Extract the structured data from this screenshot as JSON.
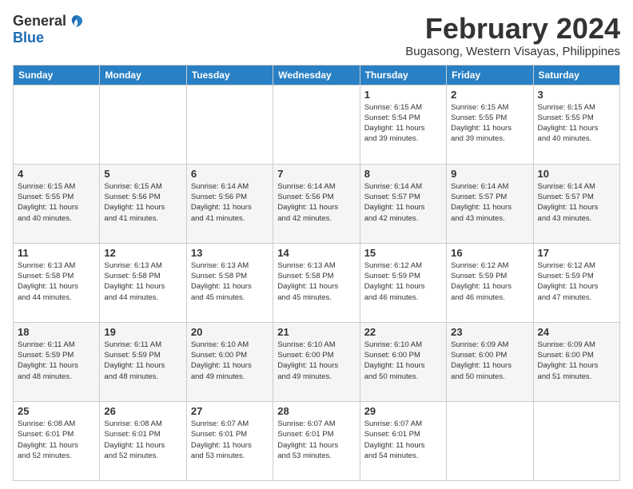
{
  "logo": {
    "general": "General",
    "blue": "Blue"
  },
  "title": {
    "month_year": "February 2024",
    "location": "Bugasong, Western Visayas, Philippines"
  },
  "weekdays": [
    "Sunday",
    "Monday",
    "Tuesday",
    "Wednesday",
    "Thursday",
    "Friday",
    "Saturday"
  ],
  "weeks": [
    [
      {
        "day": "",
        "info": ""
      },
      {
        "day": "",
        "info": ""
      },
      {
        "day": "",
        "info": ""
      },
      {
        "day": "",
        "info": ""
      },
      {
        "day": "1",
        "info": "Sunrise: 6:15 AM\nSunset: 5:54 PM\nDaylight: 11 hours\nand 39 minutes."
      },
      {
        "day": "2",
        "info": "Sunrise: 6:15 AM\nSunset: 5:55 PM\nDaylight: 11 hours\nand 39 minutes."
      },
      {
        "day": "3",
        "info": "Sunrise: 6:15 AM\nSunset: 5:55 PM\nDaylight: 11 hours\nand 40 minutes."
      }
    ],
    [
      {
        "day": "4",
        "info": "Sunrise: 6:15 AM\nSunset: 5:55 PM\nDaylight: 11 hours\nand 40 minutes."
      },
      {
        "day": "5",
        "info": "Sunrise: 6:15 AM\nSunset: 5:56 PM\nDaylight: 11 hours\nand 41 minutes."
      },
      {
        "day": "6",
        "info": "Sunrise: 6:14 AM\nSunset: 5:56 PM\nDaylight: 11 hours\nand 41 minutes."
      },
      {
        "day": "7",
        "info": "Sunrise: 6:14 AM\nSunset: 5:56 PM\nDaylight: 11 hours\nand 42 minutes."
      },
      {
        "day": "8",
        "info": "Sunrise: 6:14 AM\nSunset: 5:57 PM\nDaylight: 11 hours\nand 42 minutes."
      },
      {
        "day": "9",
        "info": "Sunrise: 6:14 AM\nSunset: 5:57 PM\nDaylight: 11 hours\nand 43 minutes."
      },
      {
        "day": "10",
        "info": "Sunrise: 6:14 AM\nSunset: 5:57 PM\nDaylight: 11 hours\nand 43 minutes."
      }
    ],
    [
      {
        "day": "11",
        "info": "Sunrise: 6:13 AM\nSunset: 5:58 PM\nDaylight: 11 hours\nand 44 minutes."
      },
      {
        "day": "12",
        "info": "Sunrise: 6:13 AM\nSunset: 5:58 PM\nDaylight: 11 hours\nand 44 minutes."
      },
      {
        "day": "13",
        "info": "Sunrise: 6:13 AM\nSunset: 5:58 PM\nDaylight: 11 hours\nand 45 minutes."
      },
      {
        "day": "14",
        "info": "Sunrise: 6:13 AM\nSunset: 5:58 PM\nDaylight: 11 hours\nand 45 minutes."
      },
      {
        "day": "15",
        "info": "Sunrise: 6:12 AM\nSunset: 5:59 PM\nDaylight: 11 hours\nand 46 minutes."
      },
      {
        "day": "16",
        "info": "Sunrise: 6:12 AM\nSunset: 5:59 PM\nDaylight: 11 hours\nand 46 minutes."
      },
      {
        "day": "17",
        "info": "Sunrise: 6:12 AM\nSunset: 5:59 PM\nDaylight: 11 hours\nand 47 minutes."
      }
    ],
    [
      {
        "day": "18",
        "info": "Sunrise: 6:11 AM\nSunset: 5:59 PM\nDaylight: 11 hours\nand 48 minutes."
      },
      {
        "day": "19",
        "info": "Sunrise: 6:11 AM\nSunset: 5:59 PM\nDaylight: 11 hours\nand 48 minutes."
      },
      {
        "day": "20",
        "info": "Sunrise: 6:10 AM\nSunset: 6:00 PM\nDaylight: 11 hours\nand 49 minutes."
      },
      {
        "day": "21",
        "info": "Sunrise: 6:10 AM\nSunset: 6:00 PM\nDaylight: 11 hours\nand 49 minutes."
      },
      {
        "day": "22",
        "info": "Sunrise: 6:10 AM\nSunset: 6:00 PM\nDaylight: 11 hours\nand 50 minutes."
      },
      {
        "day": "23",
        "info": "Sunrise: 6:09 AM\nSunset: 6:00 PM\nDaylight: 11 hours\nand 50 minutes."
      },
      {
        "day": "24",
        "info": "Sunrise: 6:09 AM\nSunset: 6:00 PM\nDaylight: 11 hours\nand 51 minutes."
      }
    ],
    [
      {
        "day": "25",
        "info": "Sunrise: 6:08 AM\nSunset: 6:01 PM\nDaylight: 11 hours\nand 52 minutes."
      },
      {
        "day": "26",
        "info": "Sunrise: 6:08 AM\nSunset: 6:01 PM\nDaylight: 11 hours\nand 52 minutes."
      },
      {
        "day": "27",
        "info": "Sunrise: 6:07 AM\nSunset: 6:01 PM\nDaylight: 11 hours\nand 53 minutes."
      },
      {
        "day": "28",
        "info": "Sunrise: 6:07 AM\nSunset: 6:01 PM\nDaylight: 11 hours\nand 53 minutes."
      },
      {
        "day": "29",
        "info": "Sunrise: 6:07 AM\nSunset: 6:01 PM\nDaylight: 11 hours\nand 54 minutes."
      },
      {
        "day": "",
        "info": ""
      },
      {
        "day": "",
        "info": ""
      }
    ]
  ]
}
